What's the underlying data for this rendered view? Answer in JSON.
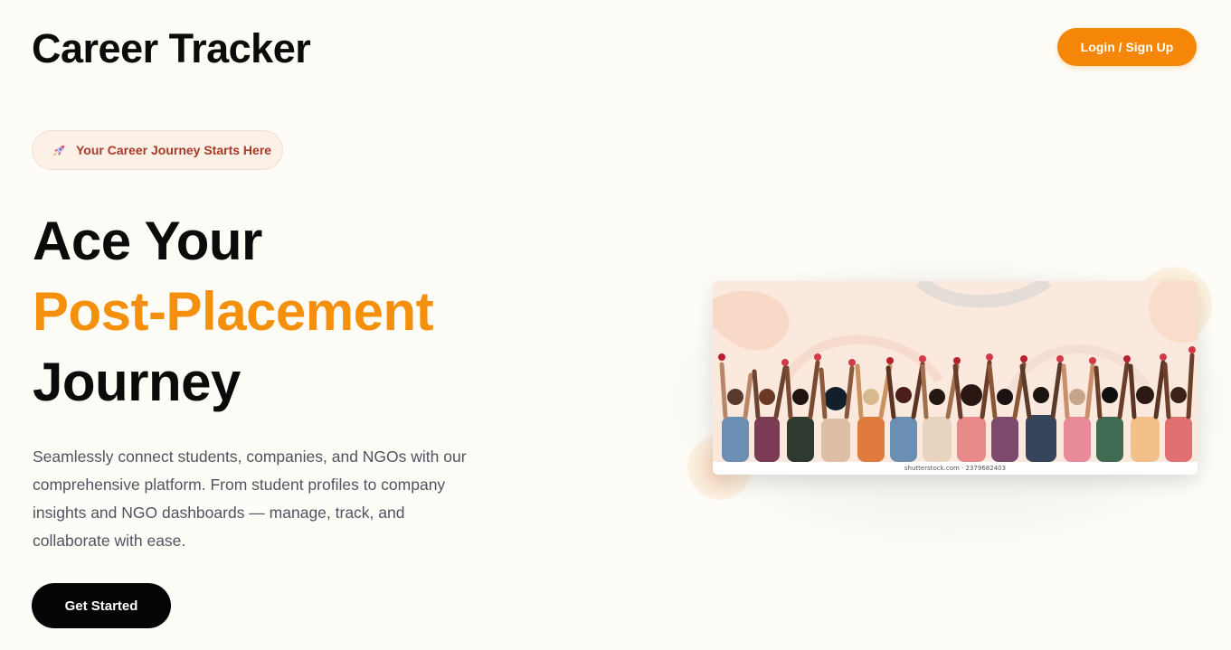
{
  "header": {
    "brand": "Career Tracker",
    "login_label": "Login / Sign Up"
  },
  "badge": {
    "icon": "rocket-icon",
    "text": "Your Career Journey Starts Here"
  },
  "hero": {
    "headline_line1": "Ace Your",
    "headline_line2": "Post-Placement",
    "headline_line3": "Journey",
    "description": "Seamlessly connect students, companies, and NGOs with our comprehensive platform. From student profiles to company insights and NGO dashboards — manage, track, and collaborate with ease.",
    "cta_label": "Get Started",
    "image_watermark": "shutterstock.com · 2379682403"
  },
  "colors": {
    "background": "#fdfcf6",
    "accent": "#f58608",
    "headline_accent": "#f5900d",
    "badge_text": "#a83a2a",
    "cta_background": "#050505"
  }
}
